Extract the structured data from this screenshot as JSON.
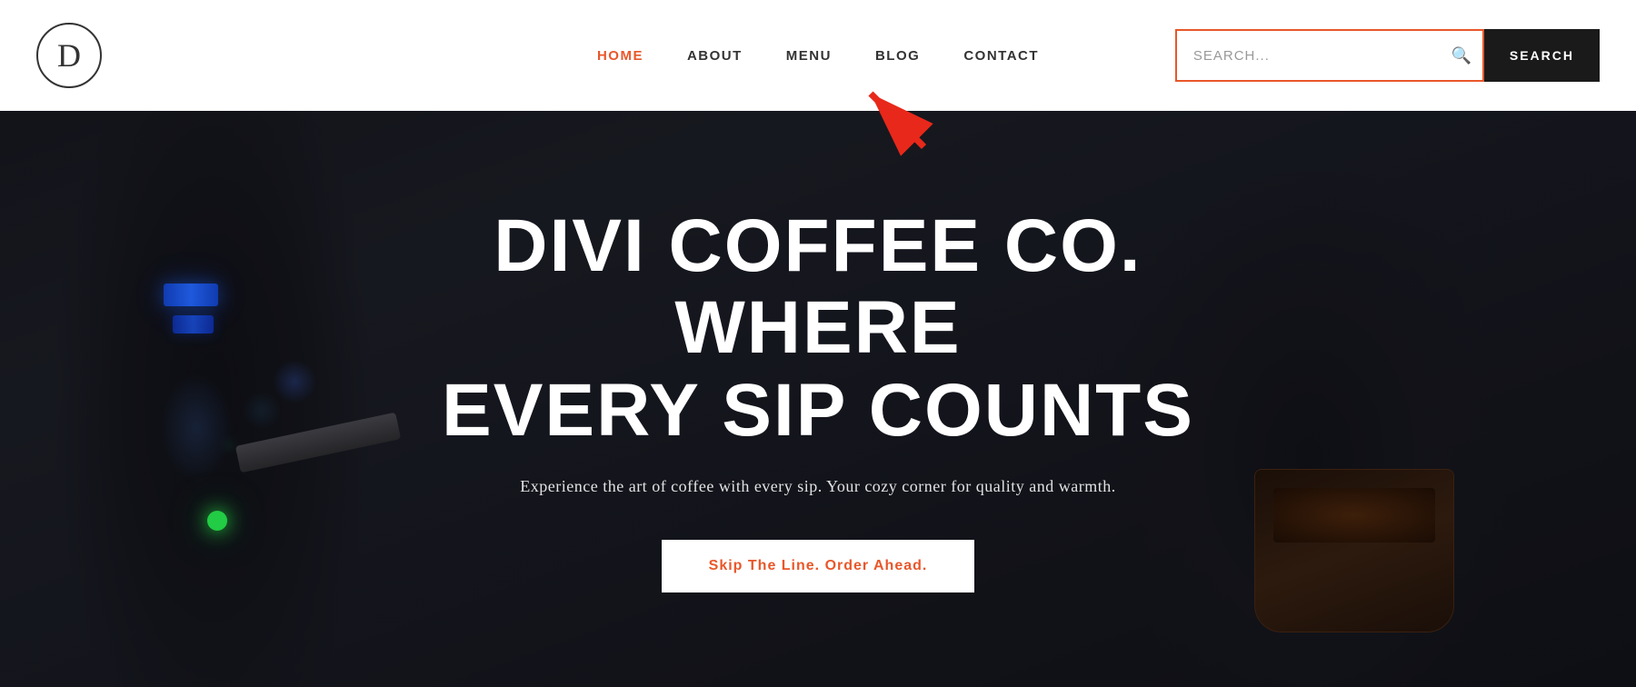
{
  "header": {
    "logo_letter": "D",
    "nav": {
      "items": [
        {
          "id": "home",
          "label": "HOME",
          "active": true
        },
        {
          "id": "about",
          "label": "ABOUT",
          "active": false
        },
        {
          "id": "menu",
          "label": "MENU",
          "active": false
        },
        {
          "id": "blog",
          "label": "BLOG",
          "active": false
        },
        {
          "id": "contact",
          "label": "CONTACT",
          "active": false
        }
      ]
    },
    "search": {
      "placeholder": "SEARCH...",
      "button_label": "SEARCH"
    }
  },
  "hero": {
    "title_line1": "DIVI COFFEE CO. WHERE",
    "title_line2": "EVERY SIP COUNTS",
    "subtitle": "Experience the art of coffee with every sip. Your cozy corner for quality and warmth.",
    "cta_label": "Skip The Line. Order Ahead."
  },
  "colors": {
    "accent": "#e8572a",
    "nav_active": "#e8572a",
    "header_bg": "#ffffff",
    "search_border": "#e8572a",
    "search_button_bg": "#1a1a1a",
    "search_button_text": "#ffffff",
    "arrow": "#e8281a"
  }
}
